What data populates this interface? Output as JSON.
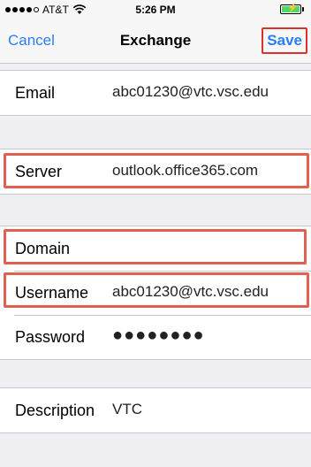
{
  "status_bar": {
    "carrier": "AT&T",
    "time": "5:26 PM",
    "battery_color": "#4cd964",
    "signal_bars_filled": 4,
    "signal_bars_total": 5
  },
  "nav": {
    "cancel_label": "Cancel",
    "title": "Exchange",
    "save_label": "Save",
    "tint_color": "#2a7ef5"
  },
  "fields": {
    "email": {
      "label": "Email",
      "value": "abc01230@vtc.vsc.edu"
    },
    "server": {
      "label": "Server",
      "value": "outlook.office365.com"
    },
    "domain": {
      "label": "Domain",
      "value": ""
    },
    "username": {
      "label": "Username",
      "value": "abc01230@vtc.vsc.edu"
    },
    "password": {
      "label": "Password",
      "value": "●●●●●●●●"
    },
    "description": {
      "label": "Description",
      "value": "VTC"
    }
  },
  "highlight_color": "#e0624e"
}
